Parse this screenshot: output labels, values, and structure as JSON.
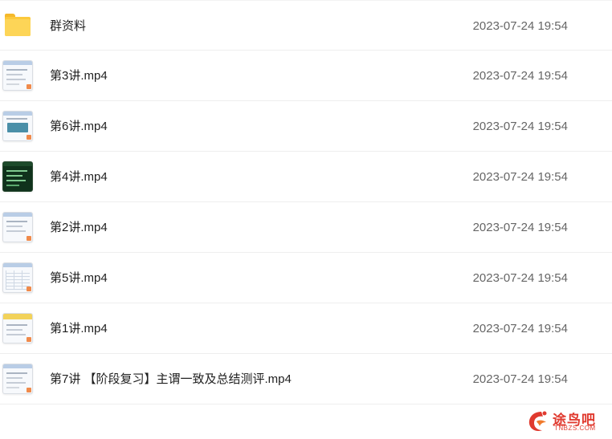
{
  "files": [
    {
      "name": "群资料",
      "date": "2023-07-24 19:54",
      "icon": "folder-icon"
    },
    {
      "name": "第3讲.mp4",
      "date": "2023-07-24 19:54",
      "icon": "video-thumbnail-icon"
    },
    {
      "name": "第6讲.mp4",
      "date": "2023-07-24 19:54",
      "icon": "video-thumbnail-icon"
    },
    {
      "name": "第4讲.mp4",
      "date": "2023-07-24 19:54",
      "icon": "video-thumbnail-icon"
    },
    {
      "name": "第2讲.mp4",
      "date": "2023-07-24 19:54",
      "icon": "video-thumbnail-icon"
    },
    {
      "name": "第5讲.mp4",
      "date": "2023-07-24 19:54",
      "icon": "video-thumbnail-icon"
    },
    {
      "name": "第1讲.mp4",
      "date": "2023-07-24 19:54",
      "icon": "video-thumbnail-icon"
    },
    {
      "name": "第7讲 【阶段复习】主谓一致及总结测评.mp4",
      "date": "2023-07-24 19:54",
      "icon": "video-thumbnail-icon"
    }
  ],
  "watermark": {
    "text": "途鸟吧",
    "sub": "TNBZS.COM",
    "color": "#e03a2f"
  }
}
